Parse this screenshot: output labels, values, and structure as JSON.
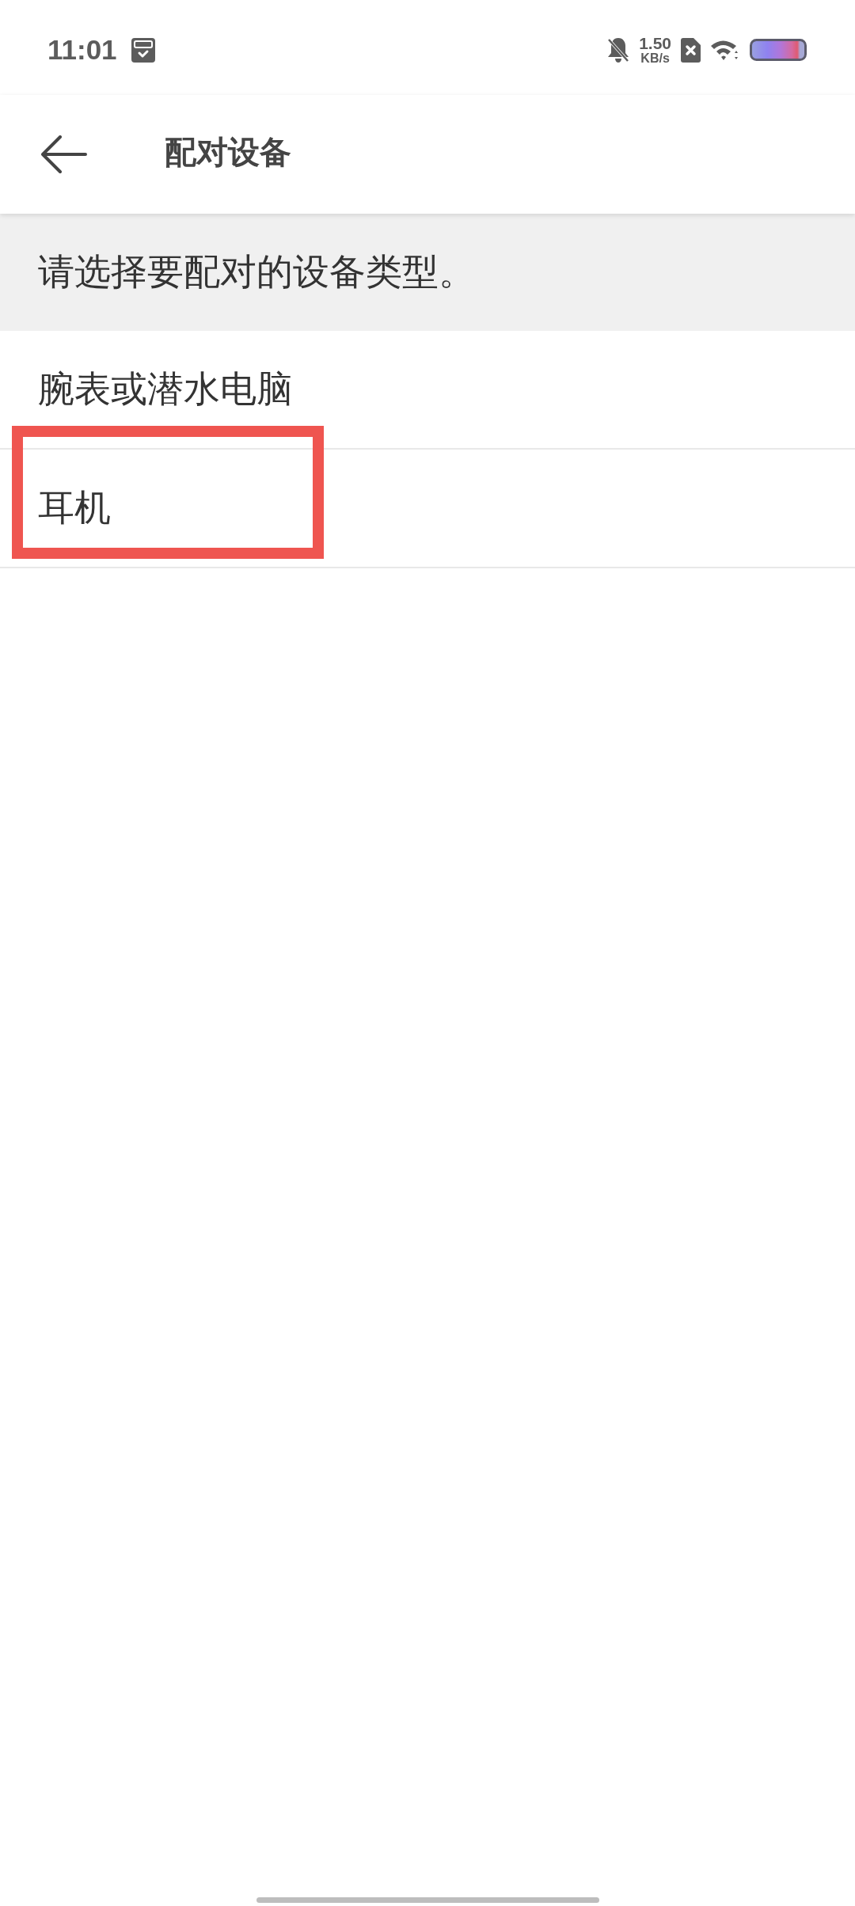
{
  "status_bar": {
    "time": "11:01",
    "network_speed": {
      "value": "1.50",
      "unit": "KB/s"
    }
  },
  "header": {
    "title": "配对设备"
  },
  "prompt": "请选择要配对的设备类型。",
  "device_types": [
    {
      "label": "腕表或潜水电脑",
      "highlighted": false
    },
    {
      "label": "耳机",
      "highlighted": true
    }
  ]
}
